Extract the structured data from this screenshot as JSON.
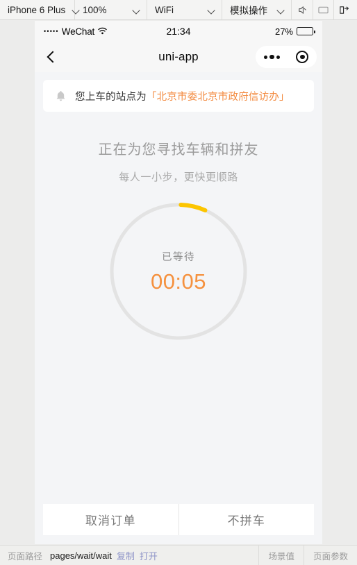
{
  "devtools": {
    "device": "iPhone 6 Plus",
    "zoom": "100%",
    "network": "WiFi",
    "simulate": "模拟操作",
    "icons": {
      "mute": "speaker-mute-icon",
      "screen": "screen-icon",
      "exit": "detach-panel-icon"
    }
  },
  "phone": {
    "statusbar": {
      "signal_dots": "•••••",
      "carrier": "WeChat",
      "wifi": "wifi-icon",
      "time": "21:34",
      "battery_percent": "27%",
      "battery_level": 27
    },
    "navbar": {
      "back": "back-chevron-icon",
      "title": "uni-app",
      "more": "ellipsis-icon",
      "target": "target-icon"
    },
    "notice": {
      "icon": "bell-icon",
      "prefix": "您上车的站点为",
      "station": "「北京市委北京市政府信访办」"
    },
    "headline": "正在为您寻找车辆和拼友",
    "subline": "每人一小步，更快更顺路",
    "timer": {
      "label": "已等待",
      "value": "00:05",
      "progress_percent": 6,
      "ring_color": "#e3e3e3",
      "progress_color": "#fcc500",
      "value_color": "#f5913e"
    },
    "buttons": [
      {
        "label": "取消订单"
      },
      {
        "label": "不拼车"
      }
    ]
  },
  "bottombar": {
    "path_label": "页面路径",
    "path_value": "pages/wait/wait",
    "copy_link": "复制",
    "open_link": "打开",
    "scene_value": "场景值",
    "page_params": "页面参数"
  }
}
